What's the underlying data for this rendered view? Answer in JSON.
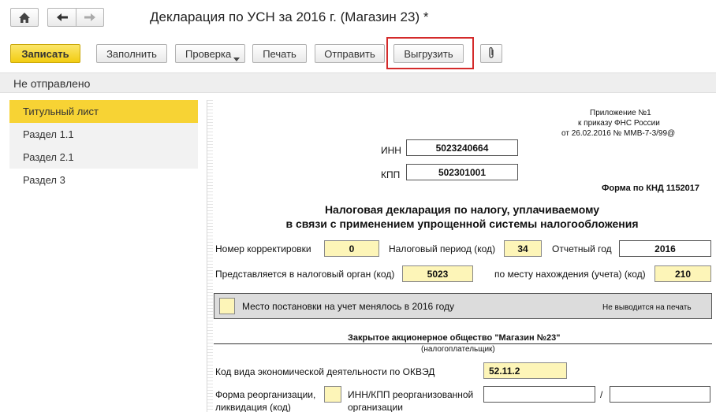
{
  "window": {
    "title": "Декларация по УСН за 2016 г. (Магазин 23) *"
  },
  "nav": {
    "home_icon": "home-icon",
    "back_icon": "arrow-left-icon",
    "forward_icon": "arrow-right-icon"
  },
  "toolbar": {
    "save_label": "Записать",
    "fill_label": "Заполнить",
    "check_label": "Проверка",
    "print_label": "Печать",
    "send_label": "Отправить",
    "export_label": "Выгрузить",
    "attach_icon": "paperclip-icon",
    "dropdown_icon": "caret-down-icon"
  },
  "status": {
    "text": "Не отправлено"
  },
  "sidebar": {
    "items": [
      {
        "label": "Титульный лист"
      },
      {
        "label": "Раздел 1.1"
      },
      {
        "label": "Раздел 2.1"
      },
      {
        "label": "Раздел 3"
      }
    ]
  },
  "form": {
    "appendix_line1": "Приложение №1",
    "appendix_line2": "к приказу ФНС России",
    "appendix_line3": "от 26.02.2016 № ММВ-7-3/99@",
    "inn_label": "ИНН",
    "inn_value": "5023240664",
    "kpp_label": "КПП",
    "kpp_value": "502301001",
    "form_code": "Форма по КНД 1152017",
    "heading_line1": "Налоговая декларация по налогу, уплачиваемому",
    "heading_line2": "в связи с применением упрощенной системы налогообложения",
    "correction_label": "Номер корректировки",
    "correction_value": "0",
    "period_label": "Налоговый период (код)",
    "period_value": "34",
    "year_label": "Отчетный год",
    "year_value": "2016",
    "authority_label": "Представляется в налоговый орган (код)",
    "authority_value": "5023",
    "location_label": "по месту нахождения (учета) (код)",
    "location_value": "210",
    "registration_changed_label": "Место постановки на учет менялось в 2016 году",
    "not_printed_label": "Не выводится на печать",
    "company_name": "Закрытое акционерное общество \"Магазин №23\"",
    "taxpayer_caption": "(налогоплательщик)",
    "okved_label": "Код вида экономической деятельности по ОКВЭД",
    "okved_value": "52.11.2",
    "reorg_label_line1": "Форма реорганизации,",
    "reorg_label_line2": "ликвидация (код)",
    "reorg_inn_label_line1": "ИНН/КПП реорганизованной",
    "reorg_inn_label_line2": "организации",
    "slash": "/"
  }
}
